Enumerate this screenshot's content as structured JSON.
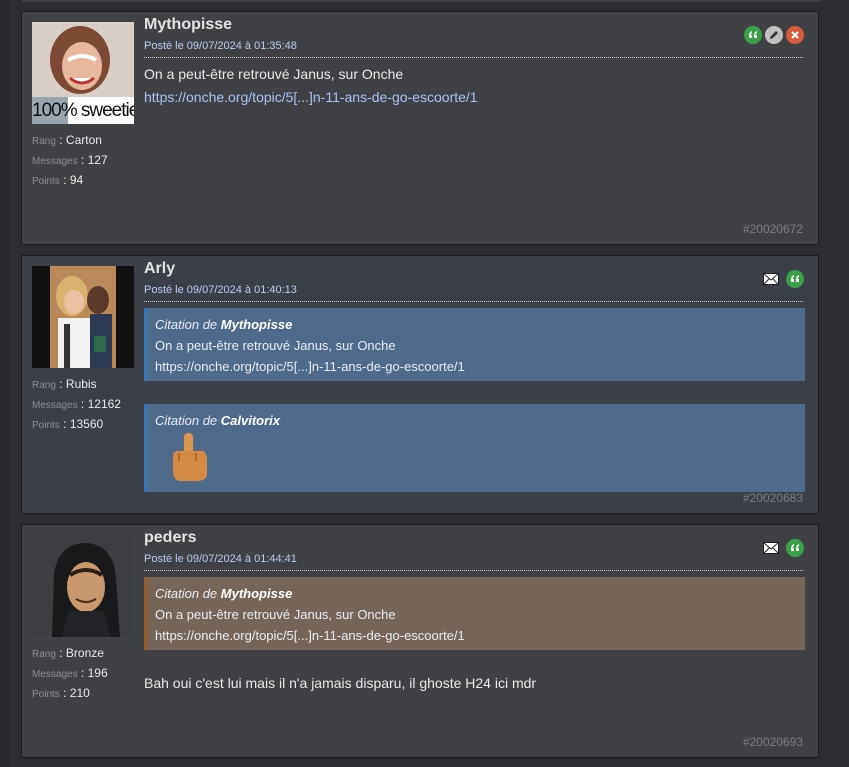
{
  "posts": [
    {
      "author": "Mythopisse",
      "date": "Posté le 09/07/2024 à 01:35:48",
      "avatar_caption": "100% sweetie",
      "stats": {
        "rank_label": "Rang",
        "rank": "Carton",
        "messages_label": "Messages",
        "messages": "127",
        "points_label": "Points",
        "points": "94"
      },
      "text": "On a peut-être retrouvé Janus, sur Onche",
      "link": "https://onche.org/topic/5[...]n-11-ans-de-go-escoorte/1",
      "id": "#20020672",
      "actions": [
        "quote-icon",
        "edit-icon",
        "delete-icon"
      ]
    },
    {
      "author": "Arly",
      "date": "Posté le 09/07/2024 à 01:40:13",
      "stats": {
        "rank_label": "Rang",
        "rank": "Rubis",
        "messages_label": "Messages",
        "messages": "12162",
        "points_label": "Points",
        "points": "13560"
      },
      "quotes": [
        {
          "prefix": "Citation de",
          "author": "Mythopisse",
          "text": "On a peut-être retrouvé Janus, sur Onche",
          "link": "https://onche.org/topic/5[...]n-11-ans-de-go-escoorte/1"
        },
        {
          "prefix": "Citation de",
          "author": "Calvitorix",
          "sticker": "middle-finger-sticker"
        }
      ],
      "id": "#20020683",
      "actions": [
        "mail-icon",
        "quote-icon"
      ]
    },
    {
      "author": "peders",
      "date": "Posté le 09/07/2024 à 01:44:41",
      "stats": {
        "rank_label": "Rang",
        "rank": "Bronze",
        "messages_label": "Messages",
        "messages": "196",
        "points_label": "Points",
        "points": "210"
      },
      "quotes": [
        {
          "prefix": "Citation de",
          "author": "Mythopisse",
          "text": "On a peut-être retrouvé Janus, sur Onche",
          "link": "https://onche.org/topic/5[...]n-11-ans-de-go-escoorte/1"
        }
      ],
      "text": "Bah oui c'est lui mais il n'a jamais disparu, il ghoste H24 ici mdr",
      "id": "#20020693",
      "actions": [
        "mail-icon",
        "quote-icon"
      ]
    }
  ],
  "colors": {
    "quote_green": "#3aa14a",
    "delete_red": "#d95a3f",
    "quote_blue_bg": "#506a8a",
    "quote_brown_bg": "#766659",
    "link": "#a6c2f2"
  }
}
